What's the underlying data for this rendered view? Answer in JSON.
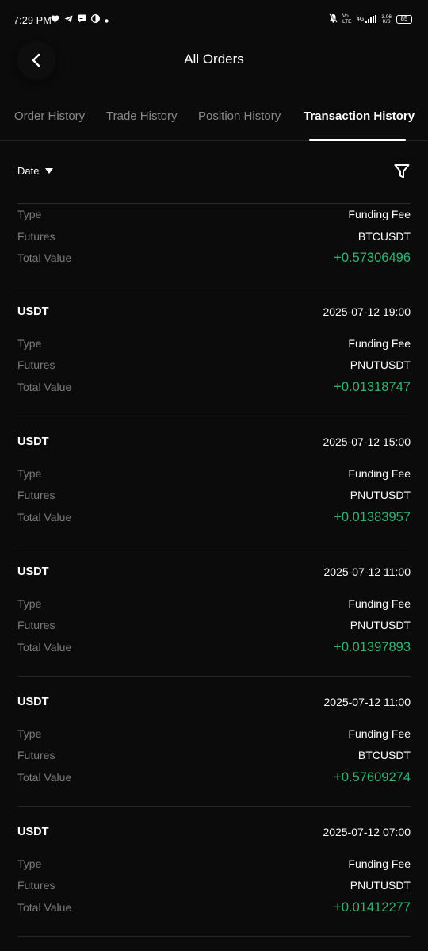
{
  "status_bar": {
    "time": "7:29 PM",
    "left_icons": [
      "heart-icon",
      "telegram-icon",
      "message-icon",
      "app-icon",
      "dot-icon"
    ],
    "right_icons": [
      "mute-icon",
      "volte-icon",
      "4g-signal-icon"
    ],
    "network_type": "4G",
    "volte": "Vo LTE",
    "speed_value": "3.06",
    "speed_unit": "K/S",
    "battery": "85"
  },
  "header": {
    "title": "All Orders",
    "back_icon": "back-arrow-icon"
  },
  "tabs": [
    {
      "label": "Order History",
      "active": false
    },
    {
      "label": "Trade History",
      "active": false
    },
    {
      "label": "Position History",
      "active": false
    },
    {
      "label": "Transaction History",
      "active": true
    }
  ],
  "filter": {
    "date_label": "Date",
    "filter_icon": "filter-funnel-icon"
  },
  "labels": {
    "type": "Type",
    "futures": "Futures",
    "total_value": "Total Value"
  },
  "colors": {
    "positive": "#34b272",
    "background": "#0b0b0b",
    "muted": "#7b7b7b"
  },
  "records": [
    {
      "coin": "",
      "time": "",
      "type": "Funding Fee",
      "futures": "BTCUSDT",
      "total_value": "+0.57306496"
    },
    {
      "coin": "USDT",
      "time": "2025-07-12 19:00",
      "type": "Funding Fee",
      "futures": "PNUTUSDT",
      "total_value": "+0.01318747"
    },
    {
      "coin": "USDT",
      "time": "2025-07-12 15:00",
      "type": "Funding Fee",
      "futures": "PNUTUSDT",
      "total_value": "+0.01383957"
    },
    {
      "coin": "USDT",
      "time": "2025-07-12 11:00",
      "type": "Funding Fee",
      "futures": "PNUTUSDT",
      "total_value": "+0.01397893"
    },
    {
      "coin": "USDT",
      "time": "2025-07-12 11:00",
      "type": "Funding Fee",
      "futures": "BTCUSDT",
      "total_value": "+0.57609274"
    },
    {
      "coin": "USDT",
      "time": "2025-07-12 07:00",
      "type": "Funding Fee",
      "futures": "PNUTUSDT",
      "total_value": "+0.01412277"
    }
  ]
}
